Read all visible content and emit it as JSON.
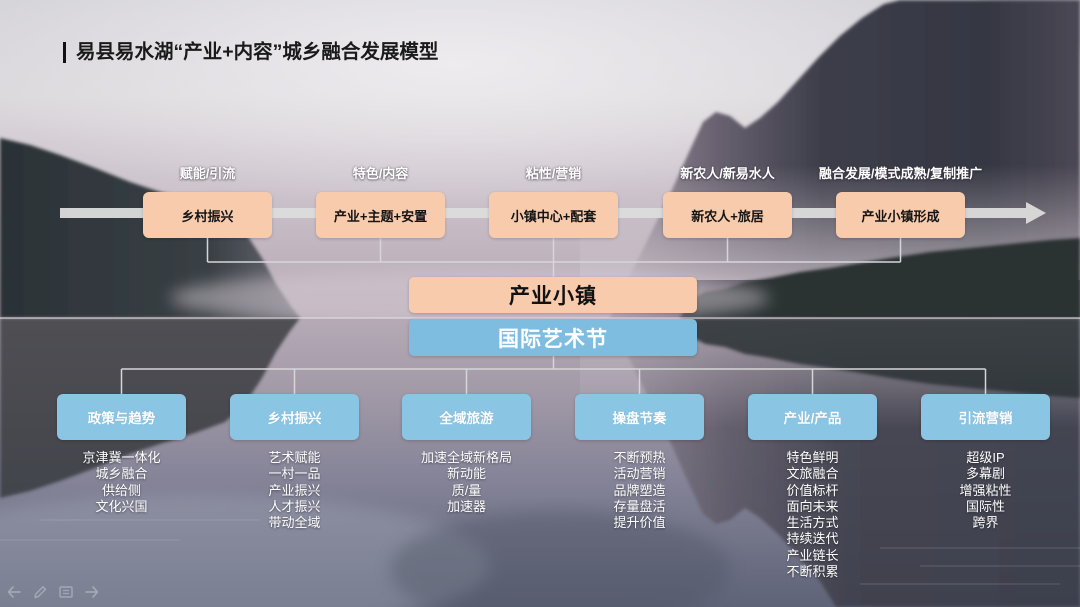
{
  "slide": {
    "title": "易县易水湖“产业+内容”城乡融合发展模型",
    "stages": [
      {
        "label": "赋能/引流",
        "name": "乡村振兴"
      },
      {
        "label": "特色/内容",
        "name": "产业+主题+安置"
      },
      {
        "label": "粘性/营销",
        "name": "小镇中心+配套"
      },
      {
        "label": "新农人/新易水人",
        "name": "新农人+旅居"
      },
      {
        "label": "融合发展/模式成熟/复制推广",
        "name": "产业小镇形成"
      }
    ],
    "core": {
      "industry_town": "产业小镇",
      "art_festival": "国际艺术节"
    },
    "pillars": [
      {
        "title": "政策与趋势",
        "items": [
          "京津冀一体化",
          "城乡融合",
          "供给侧",
          "文化兴国"
        ]
      },
      {
        "title": "乡村振兴",
        "items": [
          "艺术赋能",
          "一村一品",
          "产业振兴",
          "人才振兴",
          "带动全域"
        ]
      },
      {
        "title": "全域旅游",
        "items": [
          "加速全域新格局",
          "新动能",
          "质/量",
          "加速器"
        ]
      },
      {
        "title": "操盘节奏",
        "items": [
          "不断预热",
          "活动营销",
          "品牌塑造",
          "存量盘活",
          "提升价值"
        ]
      },
      {
        "title": "产业/产品",
        "items": [
          "特色鲜明",
          "文旅融合",
          "价值标杆",
          "面向未来",
          "生活方式",
          "持续迭代",
          "产业链长",
          "不断积累"
        ]
      },
      {
        "title": "引流营销",
        "items": [
          "超级IP",
          "多幕剧",
          "增强粘性",
          "国际性",
          "跨界"
        ]
      }
    ]
  },
  "colors": {
    "title_bar": "#111111",
    "title_text": "#1a1a1a",
    "stage_box": "#f8cbad",
    "core_box": "#f8cbad",
    "festival_box": "#7fbde0",
    "pillar_box": "#8ac5e4",
    "label_text": "#ffffff",
    "arrow": "#dcdcdc",
    "connector": "#d6d6da"
  },
  "slideshow_controls": [
    {
      "icon": "previous-slide-icon"
    },
    {
      "icon": "pen-icon"
    },
    {
      "icon": "slide-menu-icon"
    },
    {
      "icon": "next-slide-icon"
    }
  ]
}
